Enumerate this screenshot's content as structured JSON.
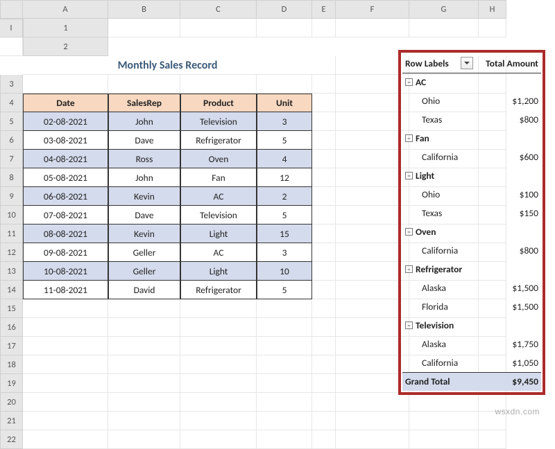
{
  "columns": [
    "A",
    "B",
    "C",
    "D",
    "E",
    "F",
    "G",
    "H",
    "I"
  ],
  "row_numbers": [
    1,
    2,
    3,
    4,
    5,
    6,
    7,
    8,
    9,
    10,
    11,
    12,
    13,
    14,
    15,
    16,
    17,
    18,
    19,
    20,
    21,
    22
  ],
  "title": "Monthly Sales Record",
  "table": {
    "headers": {
      "date": "Date",
      "salesrep": "SalesRep",
      "product": "Product",
      "unit": "Unit"
    },
    "rows": [
      {
        "date": "02-08-2021",
        "salesrep": "John",
        "product": "Television",
        "unit": "3"
      },
      {
        "date": "03-08-2021",
        "salesrep": "Dave",
        "product": "Refrigerator",
        "unit": "5"
      },
      {
        "date": "04-08-2021",
        "salesrep": "Ross",
        "product": "Oven",
        "unit": "4"
      },
      {
        "date": "05-08-2021",
        "salesrep": "John",
        "product": "Fan",
        "unit": "12"
      },
      {
        "date": "06-08-2021",
        "salesrep": "Kevin",
        "product": "AC",
        "unit": "2"
      },
      {
        "date": "07-08-2021",
        "salesrep": "Dave",
        "product": "Television",
        "unit": "5"
      },
      {
        "date": "08-08-2021",
        "salesrep": "Kevin",
        "product": "Light",
        "unit": "15"
      },
      {
        "date": "09-08-2021",
        "salesrep": "Geller",
        "product": "AC",
        "unit": "3"
      },
      {
        "date": "10-08-2021",
        "salesrep": "Geller",
        "product": "Light",
        "unit": "10"
      },
      {
        "date": "11-08-2021",
        "salesrep": "David",
        "product": "Refrigerator",
        "unit": "5"
      }
    ]
  },
  "pivot": {
    "header": {
      "row_labels": "Row Labels",
      "total_amount": "Total Amount"
    },
    "groups": [
      {
        "name": "AC",
        "children": [
          {
            "label": "Ohio",
            "amount": "$1,200"
          },
          {
            "label": "Texas",
            "amount": "$800"
          }
        ]
      },
      {
        "name": "Fan",
        "children": [
          {
            "label": "California",
            "amount": "$600"
          }
        ]
      },
      {
        "name": "Light",
        "children": [
          {
            "label": "Ohio",
            "amount": "$100"
          },
          {
            "label": "Texas",
            "amount": "$150"
          }
        ]
      },
      {
        "name": "Oven",
        "children": [
          {
            "label": "California",
            "amount": "$800"
          }
        ]
      },
      {
        "name": "Refrigerator",
        "children": [
          {
            "label": "Alaska",
            "amount": "$1,500"
          },
          {
            "label": "Florida",
            "amount": "$1,500"
          }
        ]
      },
      {
        "name": "Television",
        "children": [
          {
            "label": "Alaska",
            "amount": "$1,750"
          },
          {
            "label": "California",
            "amount": "$1,050"
          }
        ]
      }
    ],
    "grand_total": {
      "label": "Grand Total",
      "amount": "$9,450"
    }
  },
  "watermark": "wsxdn.com"
}
